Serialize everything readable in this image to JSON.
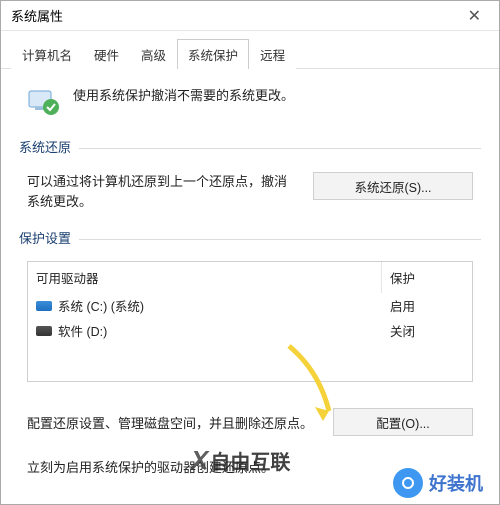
{
  "title": "系统属性",
  "tabs": [
    "计算机名",
    "硬件",
    "高级",
    "系统保护",
    "远程"
  ],
  "active_tab_index": 3,
  "intro_text": "使用系统保护撤消不需要的系统更改。",
  "group_restore": {
    "title": "系统还原",
    "desc": "可以通过将计算机还原到上一个还原点，撤消系统更改。",
    "button": "系统还原(S)..."
  },
  "group_protect": {
    "title": "保护设置",
    "columns": {
      "drive": "可用驱动器",
      "prot": "保护"
    },
    "drives": [
      {
        "icon": "sys",
        "name": "系统 (C:) (系统)",
        "prot": "启用"
      },
      {
        "icon": "data",
        "name": "软件 (D:)",
        "prot": "关闭"
      }
    ],
    "config_desc": "配置还原设置、管理磁盘空间，并且删除还原点。",
    "config_button": "配置(O)...",
    "create_desc": "立刻为启用系统保护的驱动器创建还原点。"
  },
  "watermarks": {
    "wm1": "自由互联",
    "wm2": "好装机"
  }
}
